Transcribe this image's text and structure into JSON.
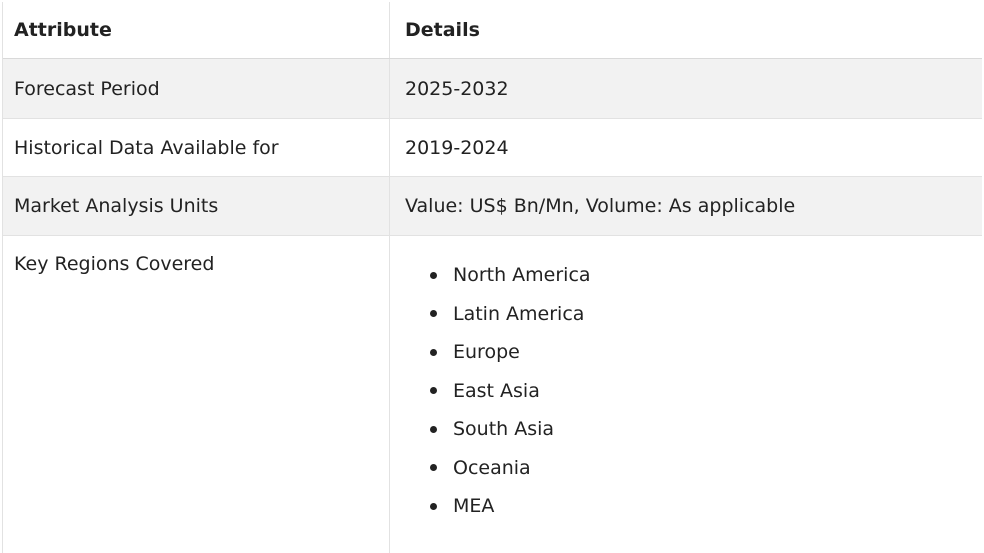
{
  "header": {
    "attribute": "Attribute",
    "details": "Details"
  },
  "rows": [
    {
      "attribute": "Forecast Period",
      "details": "2025-2032"
    },
    {
      "attribute": "Historical Data Available for",
      "details": "2019-2024"
    },
    {
      "attribute": "Market Analysis Units",
      "details": "Value: US$ Bn/Mn, Volume: As applicable"
    },
    {
      "attribute": "Key Regions Covered"
    }
  ],
  "regions": [
    "North America",
    "Latin America",
    "Europe",
    "East Asia",
    "South Asia",
    "Oceania",
    "MEA"
  ]
}
